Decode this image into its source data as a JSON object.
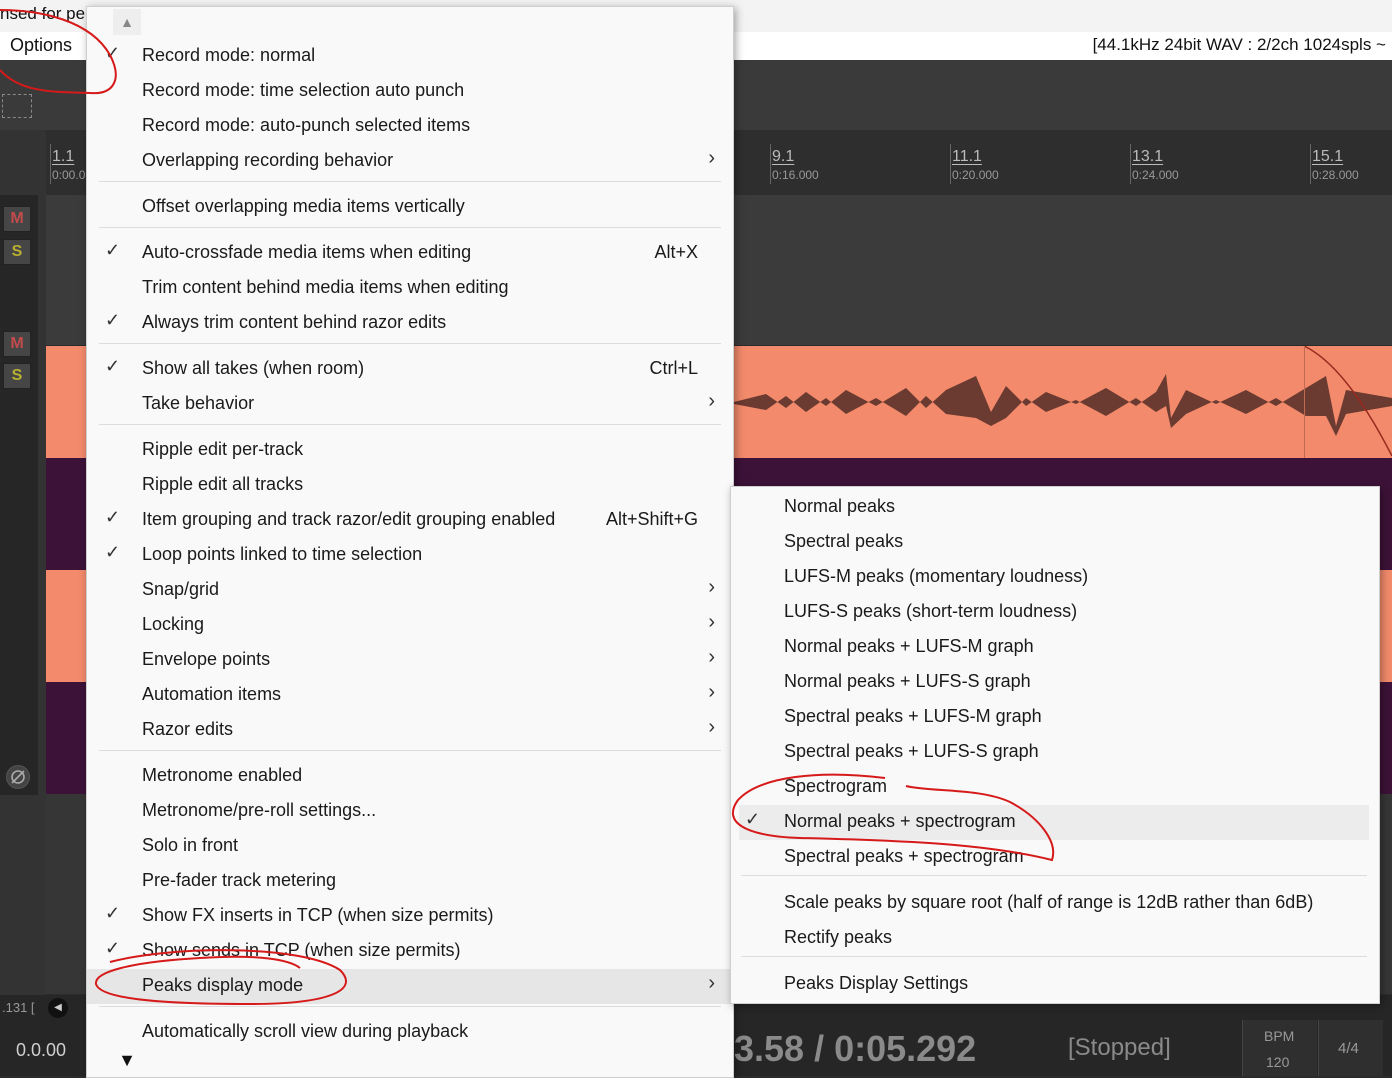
{
  "window": {
    "title_fragment": "nsed for pe",
    "options_menu": "Options",
    "audio_info": "[44.1kHz 24bit WAV : 2/2ch 1024spls ~"
  },
  "tcp": {
    "mute_label": "M",
    "solo_label": "S"
  },
  "ruler": {
    "ticks": [
      {
        "bar": "1.1",
        "time": "0:00.0"
      },
      {
        "bar": "9.1",
        "time": "0:16.000"
      },
      {
        "bar": "11.1",
        "time": "0:20.000"
      },
      {
        "bar": "13.1",
        "time": "0:24.000"
      },
      {
        "bar": "15.1",
        "time": "0:28.000"
      }
    ]
  },
  "transport": {
    "left_position": "0.0.00",
    "rate_fragment": ".131 [",
    "time_display": "3.58 / 0:05.292",
    "status": "[Stopped]",
    "bpm_label": "BPM",
    "bpm_value": "120",
    "time_signature": "4/4"
  },
  "menu": {
    "scroll_up_icon": "triangle-up-icon",
    "scroll_down_icon": "triangle-down-icon",
    "items": [
      {
        "label": "Record mode: normal",
        "checked": true,
        "shortcut": "",
        "submenu": false
      },
      {
        "label": "Record mode: time selection auto punch",
        "checked": false,
        "shortcut": "",
        "submenu": false
      },
      {
        "label": "Record mode: auto-punch selected items",
        "checked": false,
        "shortcut": "",
        "submenu": false
      },
      {
        "label": "Overlapping recording behavior",
        "checked": false,
        "shortcut": "",
        "submenu": true
      },
      {
        "label": "Offset overlapping media items vertically",
        "checked": false,
        "shortcut": "",
        "submenu": false
      },
      {
        "label": "Auto-crossfade media items when editing",
        "checked": true,
        "shortcut": "Alt+X",
        "submenu": false
      },
      {
        "label": "Trim content behind media items when editing",
        "checked": false,
        "shortcut": "",
        "submenu": false
      },
      {
        "label": "Always trim content behind razor edits",
        "checked": true,
        "shortcut": "",
        "submenu": false
      },
      {
        "label": "Show all takes (when room)",
        "checked": true,
        "shortcut": "Ctrl+L",
        "submenu": false
      },
      {
        "label": "Take behavior",
        "checked": false,
        "shortcut": "",
        "submenu": true
      },
      {
        "label": "Ripple edit per-track",
        "checked": false,
        "shortcut": "",
        "submenu": false
      },
      {
        "label": "Ripple edit all tracks",
        "checked": false,
        "shortcut": "",
        "submenu": false
      },
      {
        "label": "Item grouping and track razor/edit grouping enabled",
        "checked": true,
        "shortcut": "Alt+Shift+G",
        "submenu": false
      },
      {
        "label": "Loop points linked to time selection",
        "checked": true,
        "shortcut": "",
        "submenu": false
      },
      {
        "label": "Snap/grid",
        "checked": false,
        "shortcut": "",
        "submenu": true
      },
      {
        "label": "Locking",
        "checked": false,
        "shortcut": "",
        "submenu": true
      },
      {
        "label": "Envelope points",
        "checked": false,
        "shortcut": "",
        "submenu": true
      },
      {
        "label": "Automation items",
        "checked": false,
        "shortcut": "",
        "submenu": true
      },
      {
        "label": "Razor edits",
        "checked": false,
        "shortcut": "",
        "submenu": true
      },
      {
        "label": "Metronome enabled",
        "checked": false,
        "shortcut": "",
        "submenu": false
      },
      {
        "label": "Metronome/pre-roll settings...",
        "checked": false,
        "shortcut": "",
        "submenu": false
      },
      {
        "label": "Solo in front",
        "checked": false,
        "shortcut": "",
        "submenu": false
      },
      {
        "label": "Pre-fader track metering",
        "checked": false,
        "shortcut": "",
        "submenu": false
      },
      {
        "label": "Show FX inserts in TCP (when size permits)",
        "checked": true,
        "shortcut": "",
        "submenu": false
      },
      {
        "label": "Show sends in TCP (when size permits)",
        "checked": true,
        "shortcut": "",
        "submenu": false
      },
      {
        "label": "Peaks display mode",
        "checked": false,
        "shortcut": "",
        "submenu": true,
        "highlighted": true
      },
      {
        "label": "Automatically scroll view during playback",
        "checked": false,
        "shortcut": "",
        "submenu": false
      }
    ]
  },
  "submenu": {
    "items": [
      {
        "label": "Normal peaks",
        "checked": false
      },
      {
        "label": "Spectral peaks",
        "checked": false
      },
      {
        "label": "LUFS-M peaks (momentary loudness)",
        "checked": false
      },
      {
        "label": "LUFS-S peaks (short-term loudness)",
        "checked": false
      },
      {
        "label": "Normal peaks + LUFS-M graph",
        "checked": false
      },
      {
        "label": "Normal peaks + LUFS-S graph",
        "checked": false
      },
      {
        "label": "Spectral peaks + LUFS-M graph",
        "checked": false
      },
      {
        "label": "Spectral peaks + LUFS-S graph",
        "checked": false
      },
      {
        "label": "Spectrogram",
        "checked": false
      },
      {
        "label": "Normal peaks + spectrogram",
        "checked": true,
        "highlighted": true
      },
      {
        "label": "Spectral peaks + spectrogram",
        "checked": false
      },
      {
        "label": "Scale peaks by square root (half of range is 12dB rather than 6dB)",
        "checked": false
      },
      {
        "label": "Rectify peaks",
        "checked": false
      },
      {
        "label": "Peaks Display Settings",
        "checked": false
      }
    ]
  },
  "colors": {
    "item_peaks": "#f28a6b",
    "waveform": "#6b3a30",
    "spectrogram": "#3d1238",
    "annotation": "#d61a1a",
    "menu_bg": "#f9f9f9"
  }
}
